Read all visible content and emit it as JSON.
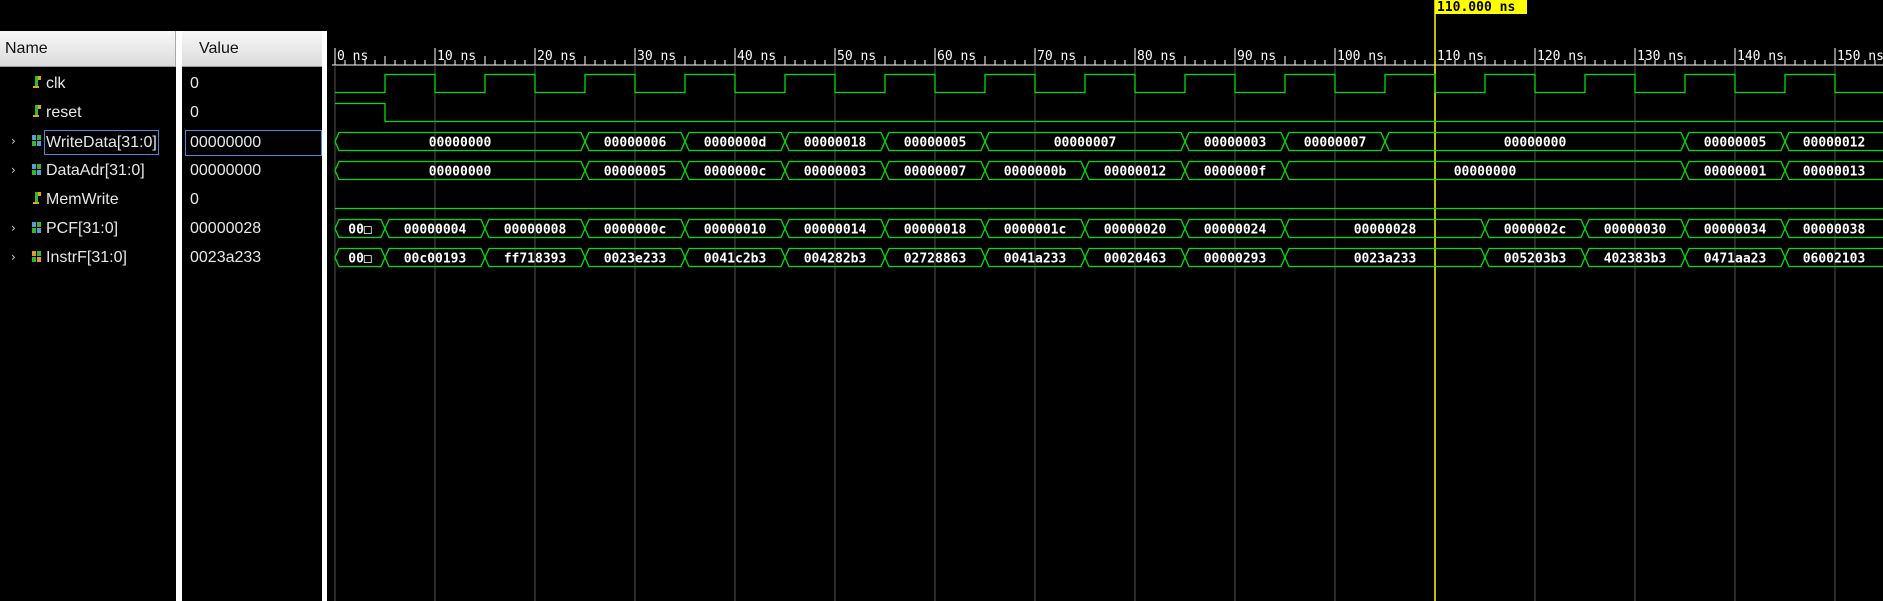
{
  "headers": {
    "name": "Name",
    "value": "Value"
  },
  "signals": [
    {
      "id": "clk",
      "name": "clk",
      "value": "0",
      "kind": "bit",
      "icon": "bit-signal-icon",
      "expandable": false
    },
    {
      "id": "reset",
      "name": "reset",
      "value": "0",
      "kind": "bit",
      "icon": "bit-signal-icon",
      "expandable": false
    },
    {
      "id": "writedata",
      "name": "WriteData[31:0]",
      "value": "00000000",
      "kind": "bus",
      "icon": "bus-signal-icon",
      "expandable": true,
      "selected": true
    },
    {
      "id": "dataadr",
      "name": "DataAdr[31:0]",
      "value": "00000000",
      "kind": "bus",
      "icon": "bus-signal-icon",
      "expandable": true
    },
    {
      "id": "memwrite",
      "name": "MemWrite",
      "value": "0",
      "kind": "bit",
      "icon": "bit-signal-icon",
      "expandable": false
    },
    {
      "id": "pcf",
      "name": "PCF[31:0]",
      "value": "00000028",
      "kind": "bus",
      "icon": "bus-signal-icon",
      "expandable": true
    },
    {
      "id": "instrf",
      "name": "InstrF[31:0]",
      "value": "0023a233",
      "kind": "bus",
      "icon": "bus-signal-icon-orange",
      "expandable": true
    }
  ],
  "timeline": {
    "unit": "ns",
    "tick_step_ns": 10,
    "ticks": [
      "0 ns",
      "10 ns",
      "20 ns",
      "30 ns",
      "40 ns",
      "50 ns",
      "60 ns",
      "70 ns",
      "80 ns",
      "90 ns",
      "100 ns",
      "110 ns",
      "120 ns",
      "130 ns",
      "140 ns",
      "150 ns"
    ],
    "cursor_ns": 110,
    "cursor_label": "110.000 ns"
  },
  "waveforms": {
    "clk": {
      "initial": 0,
      "edges_ns": [
        5,
        10,
        15,
        20,
        25,
        30,
        35,
        40,
        45,
        50,
        55,
        60,
        65,
        70,
        75,
        80,
        85,
        90,
        95,
        100,
        105,
        110,
        115,
        120,
        125,
        130,
        135,
        140,
        145,
        150,
        155
      ]
    },
    "reset": {
      "initial": 1,
      "edges_ns": [
        5
      ]
    },
    "memwrite": {
      "initial": 0,
      "edges_ns": []
    },
    "writedata": [
      {
        "start": 0,
        "end": 25,
        "label": "00000000"
      },
      {
        "start": 25,
        "end": 35,
        "label": "00000006"
      },
      {
        "start": 35,
        "end": 45,
        "label": "0000000d"
      },
      {
        "start": 45,
        "end": 55,
        "label": "00000018"
      },
      {
        "start": 55,
        "end": 65,
        "label": "00000005"
      },
      {
        "start": 65,
        "end": 85,
        "label": "00000007"
      },
      {
        "start": 85,
        "end": 95,
        "label": "00000003"
      },
      {
        "start": 95,
        "end": 105,
        "label": "00000007"
      },
      {
        "start": 105,
        "end": 135,
        "label": "00000000"
      },
      {
        "start": 135,
        "end": 145,
        "label": "00000005"
      },
      {
        "start": 145,
        "end": 160,
        "label": "00000012"
      }
    ],
    "dataadr": [
      {
        "start": 0,
        "end": 25,
        "label": "00000000"
      },
      {
        "start": 25,
        "end": 35,
        "label": "00000005"
      },
      {
        "start": 35,
        "end": 45,
        "label": "0000000c"
      },
      {
        "start": 45,
        "end": 55,
        "label": "00000003"
      },
      {
        "start": 55,
        "end": 65,
        "label": "00000007"
      },
      {
        "start": 65,
        "end": 75,
        "label": "0000000b"
      },
      {
        "start": 75,
        "end": 85,
        "label": "00000012"
      },
      {
        "start": 85,
        "end": 95,
        "label": "0000000f"
      },
      {
        "start": 95,
        "end": 135,
        "label": "00000000"
      },
      {
        "start": 135,
        "end": 145,
        "label": "00000001"
      },
      {
        "start": 145,
        "end": 160,
        "label": "00000013"
      }
    ],
    "pcf": [
      {
        "start": 0,
        "end": 5,
        "label": "00□"
      },
      {
        "start": 5,
        "end": 15,
        "label": "00000004"
      },
      {
        "start": 15,
        "end": 25,
        "label": "00000008"
      },
      {
        "start": 25,
        "end": 35,
        "label": "0000000c"
      },
      {
        "start": 35,
        "end": 45,
        "label": "00000010"
      },
      {
        "start": 45,
        "end": 55,
        "label": "00000014"
      },
      {
        "start": 55,
        "end": 65,
        "label": "00000018"
      },
      {
        "start": 65,
        "end": 75,
        "label": "0000001c"
      },
      {
        "start": 75,
        "end": 85,
        "label": "00000020"
      },
      {
        "start": 85,
        "end": 95,
        "label": "00000024"
      },
      {
        "start": 95,
        "end": 115,
        "label": "00000028"
      },
      {
        "start": 115,
        "end": 125,
        "label": "0000002c"
      },
      {
        "start": 125,
        "end": 135,
        "label": "00000030"
      },
      {
        "start": 135,
        "end": 145,
        "label": "00000034"
      },
      {
        "start": 145,
        "end": 160,
        "label": "00000038"
      }
    ],
    "instrf": [
      {
        "start": 0,
        "end": 5,
        "label": "00□"
      },
      {
        "start": 5,
        "end": 15,
        "label": "00c00193"
      },
      {
        "start": 15,
        "end": 25,
        "label": "ff718393"
      },
      {
        "start": 25,
        "end": 35,
        "label": "0023e233"
      },
      {
        "start": 35,
        "end": 45,
        "label": "0041c2b3"
      },
      {
        "start": 45,
        "end": 55,
        "label": "004282b3"
      },
      {
        "start": 55,
        "end": 65,
        "label": "02728863"
      },
      {
        "start": 65,
        "end": 75,
        "label": "0041a233"
      },
      {
        "start": 75,
        "end": 85,
        "label": "00020463"
      },
      {
        "start": 85,
        "end": 95,
        "label": "00000293"
      },
      {
        "start": 95,
        "end": 115,
        "label": "0023a233"
      },
      {
        "start": 115,
        "end": 125,
        "label": "005203b3"
      },
      {
        "start": 125,
        "end": 135,
        "label": "402383b3"
      },
      {
        "start": 135,
        "end": 145,
        "label": "0471aa23"
      },
      {
        "start": 145,
        "end": 160,
        "label": "06002103"
      }
    ]
  },
  "colors": {
    "wave": "#00e000",
    "cursor": "#ffff00",
    "gridline": "#555555",
    "background": "#000000"
  }
}
